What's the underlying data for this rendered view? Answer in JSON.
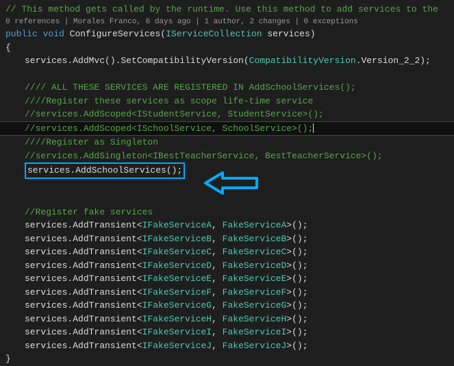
{
  "comment_header": "// This method gets called by the runtime. Use this method to add services to the",
  "codelens": "0 references | Morales Franco, 6 days ago | 1 author, 2 changes | 0 exceptions",
  "kw_public": "public",
  "kw_void": "void",
  "method_name": "ConfigureServices",
  "param_type": "IServiceCollection",
  "param_name": "services",
  "ln_addmvc_a": "services.AddMvc().SetCompatibilityVersion(",
  "ln_addmvc_type": "CompatibilityVersion",
  "ln_addmvc_b": ".Version_2_2);",
  "cmt1": "//// ALL THESE SERVICES ARE REGISTERED IN AddSchoolServices();",
  "cmt2": "////Register these services as scope life-time service",
  "cmt3": "//services.AddScoped<IStudentService, StudentService>();",
  "cmt4": "//services.AddScoped<ISchoolService, SchoolService>();",
  "cmt5": "////Register as Singleton",
  "cmt6_a": "//services.AddSingleton<IBestTea",
  "cmt6_b": "cherSe",
  "cmt6_c": "rvice, BestTeacherService>();",
  "boxed_line": "services.AddSchoolServices();",
  "cmt_fake": "//Register fake services",
  "fake": [
    {
      "pre": "services.AddTransient<",
      "iface": "IFakeServiceA",
      "mid": ", ",
      "impl": "FakeServiceA",
      "post": ">();"
    },
    {
      "pre": "services.AddTransient<",
      "iface": "IFakeServiceB",
      "mid": ", ",
      "impl": "FakeServiceB",
      "post": ">();"
    },
    {
      "pre": "services.AddTransient<",
      "iface": "IFakeServiceC",
      "mid": ", ",
      "impl": "FakeServiceC",
      "post": ">();"
    },
    {
      "pre": "services.AddTransient<",
      "iface": "IFakeServiceD",
      "mid": ", ",
      "impl": "FakeServiceD",
      "post": ">();"
    },
    {
      "pre": "services.AddTransient<",
      "iface": "IFakeServiceE",
      "mid": ", ",
      "impl": "FakeServiceE",
      "post": ">();"
    },
    {
      "pre": "services.AddTransient<",
      "iface": "IFakeServiceF",
      "mid": ", ",
      "impl": "FakeServiceF",
      "post": ">();"
    },
    {
      "pre": "services.AddTransient<",
      "iface": "IFakeServiceG",
      "mid": ", ",
      "impl": "FakeServiceG",
      "post": ">();"
    },
    {
      "pre": "services.AddTransient<",
      "iface": "IFakeServiceH",
      "mid": ", ",
      "impl": "FakeServiceH",
      "post": ">();"
    },
    {
      "pre": "services.AddTransient<",
      "iface": "IFakeServiceI",
      "mid": ", ",
      "impl": "FakeServiceI",
      "post": ">();"
    },
    {
      "pre": "services.AddTransient<",
      "iface": "IFakeServiceJ",
      "mid": ", ",
      "impl": "FakeServiceJ",
      "post": ">();"
    }
  ]
}
